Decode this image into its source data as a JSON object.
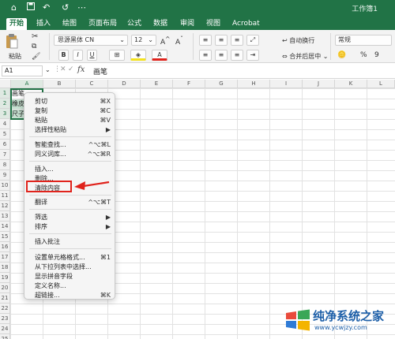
{
  "window": {
    "title": "工作簿1"
  },
  "tabs": [
    "开始",
    "插入",
    "绘图",
    "页面布局",
    "公式",
    "数据",
    "审阅",
    "视图",
    "Acrobat"
  ],
  "ribbon": {
    "paste_label": "粘贴",
    "font_name": "思源黑体 CN",
    "font_size": "12",
    "wrap_text": "自动换行",
    "number_format": "常规",
    "merge_center": "合并后居中",
    "percent": "%"
  },
  "formula_bar": {
    "cell_ref": "A1",
    "fx": "fx",
    "value": "画笔"
  },
  "columns": [
    "A",
    "B",
    "C",
    "D",
    "E",
    "F",
    "G",
    "H",
    "I",
    "J",
    "K",
    "L"
  ],
  "rows": [
    "1",
    "2",
    "3",
    "4",
    "5",
    "6",
    "7",
    "8",
    "9",
    "10",
    "11",
    "12",
    "13",
    "14",
    "15",
    "16",
    "17",
    "18",
    "19",
    "20",
    "21",
    "22",
    "23",
    "24",
    "25"
  ],
  "cells": [
    "画笔",
    "橡皮",
    "尺子"
  ],
  "context_menu": {
    "items": [
      {
        "label": "剪切",
        "shortcut": "⌘X"
      },
      {
        "label": "复制",
        "shortcut": "⌘C"
      },
      {
        "label": "粘贴",
        "shortcut": "⌘V"
      },
      {
        "label": "选择性粘贴",
        "shortcut": "▶"
      },
      {
        "label": "智能查找...",
        "shortcut": "^⌥⌘L"
      },
      {
        "label": "同义词库...",
        "shortcut": "^⌥⌘R"
      },
      {
        "label": "插入...",
        "shortcut": ""
      },
      {
        "label": "删除...",
        "shortcut": ""
      },
      {
        "label": "清除内容",
        "shortcut": ""
      },
      {
        "label": "翻译",
        "shortcut": "^⌥⌘T"
      },
      {
        "label": "筛选",
        "shortcut": "▶"
      },
      {
        "label": "排序",
        "shortcut": "▶"
      },
      {
        "label": "插入批注",
        "shortcut": ""
      },
      {
        "label": "设置单元格格式...",
        "shortcut": "⌘1"
      },
      {
        "label": "从下拉列表中选择...",
        "shortcut": ""
      },
      {
        "label": "显示拼音字段",
        "shortcut": ""
      },
      {
        "label": "定义名称...",
        "shortcut": ""
      },
      {
        "label": "超链接...",
        "shortcut": "⌘K"
      }
    ]
  },
  "watermark": {
    "text": "纯净系统之家",
    "url": "www.ycwjzy.com"
  },
  "colors": {
    "brand": "#217346",
    "highlight": "#e0231c",
    "watermark": "#1d5fa8"
  },
  "icons": [
    "home-icon",
    "save-icon",
    "undo-icon",
    "redo-icon",
    "more-icon"
  ]
}
